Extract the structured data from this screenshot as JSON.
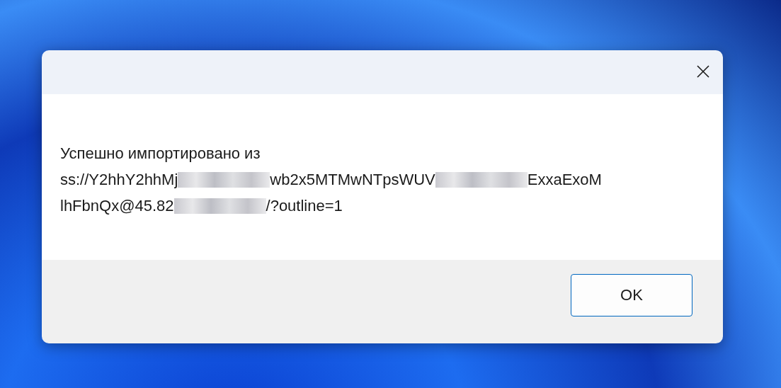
{
  "dialog": {
    "message_lines": [
      [
        {
          "kind": "text",
          "text": "Успешно импортировано из"
        }
      ],
      [
        {
          "kind": "text",
          "text": "ss://Y2hhY2hhMj"
        },
        {
          "kind": "redacted"
        },
        {
          "kind": "text",
          "text": "wb2x5MTMwNTpsWUV"
        },
        {
          "kind": "redacted"
        },
        {
          "kind": "text",
          "text": "ExxaExoM"
        }
      ],
      [
        {
          "kind": "text",
          "text": "lhFbnQx@45.82"
        },
        {
          "kind": "redacted"
        },
        {
          "kind": "text",
          "text": "/?outline=1"
        }
      ]
    ],
    "buttons": [
      "OK"
    ]
  }
}
